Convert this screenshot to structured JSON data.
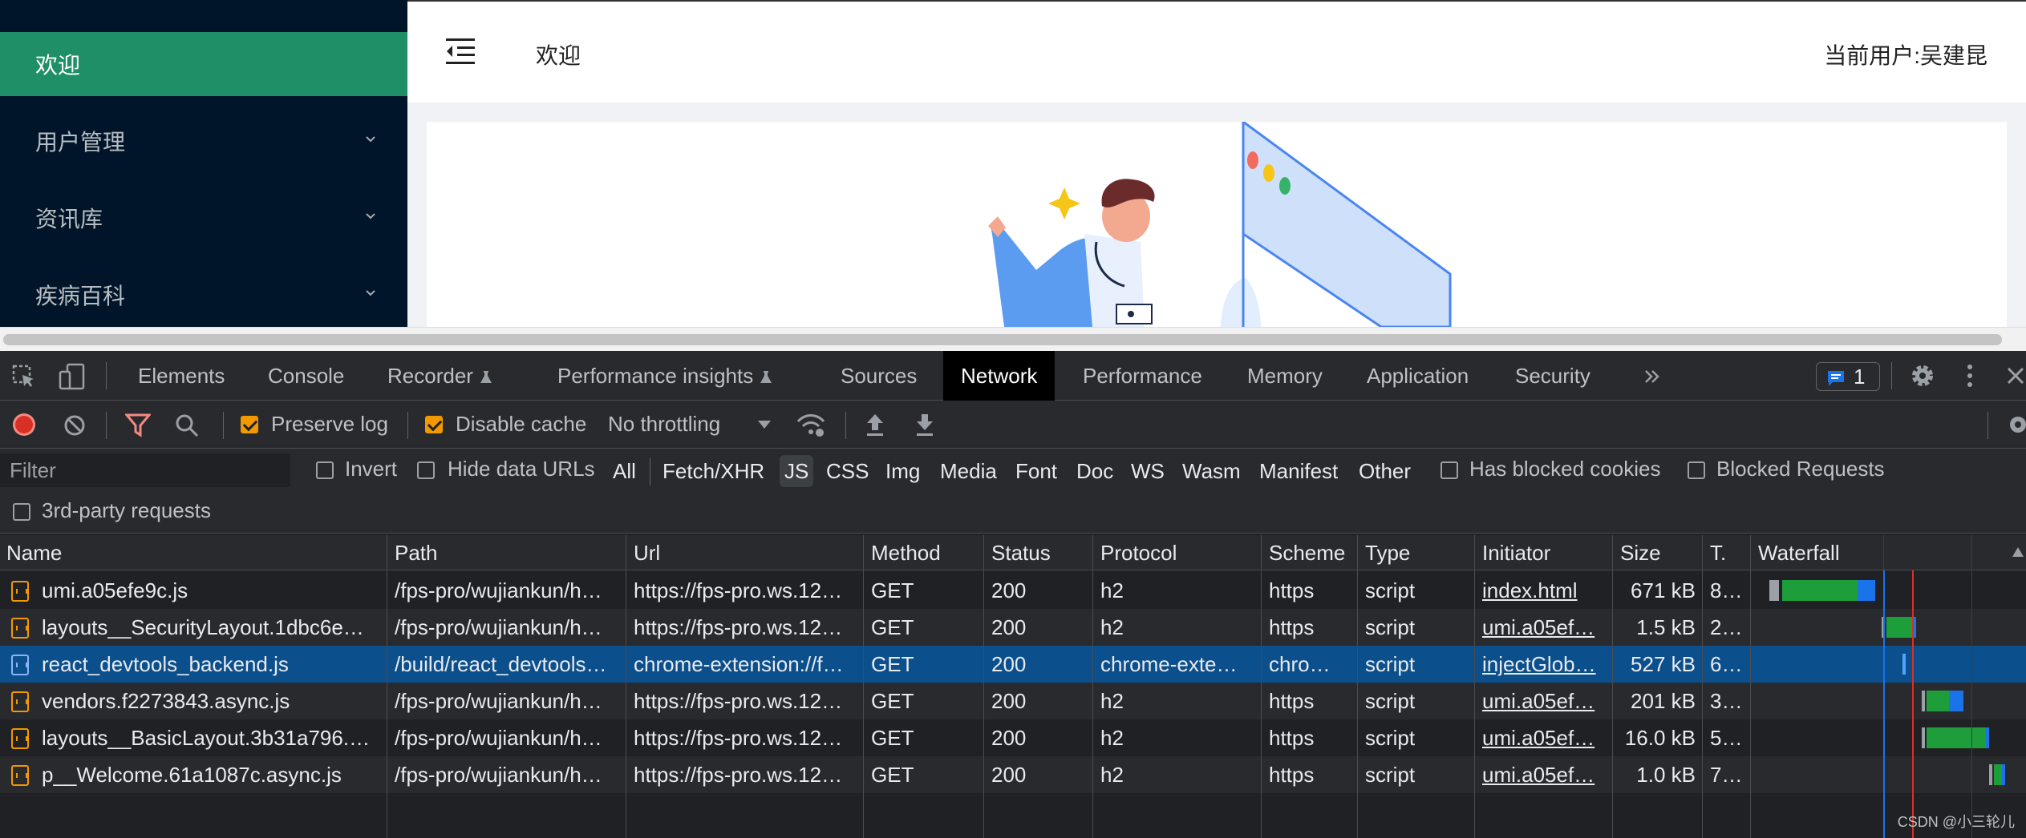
{
  "sidebar": {
    "items": [
      {
        "label": "欢迎",
        "active": true
      },
      {
        "label": "用户管理"
      },
      {
        "label": "资讯库"
      },
      {
        "label": "疾病百科"
      }
    ]
  },
  "header": {
    "title": "欢迎",
    "user": "当前用户:吴建昆"
  },
  "devtools": {
    "tabs": [
      "Elements",
      "Console",
      "Recorder",
      "Performance insights",
      "Sources",
      "Network",
      "Performance",
      "Memory",
      "Application",
      "Security"
    ],
    "active_tab": "Network",
    "issues_count": "1",
    "toolbar": {
      "preserve_log": "Preserve log",
      "disable_cache": "Disable cache",
      "throttling": "No throttling"
    },
    "filter": {
      "placeholder": "Filter",
      "invert": "Invert",
      "hide_data_urls": "Hide data URLs",
      "types": [
        "All",
        "Fetch/XHR",
        "JS",
        "CSS",
        "Img",
        "Media",
        "Font",
        "Doc",
        "WS",
        "Wasm",
        "Manifest",
        "Other"
      ],
      "active_type": "JS",
      "has_blocked_cookies": "Has blocked cookies",
      "blocked_requests": "Blocked Requests",
      "third_party": "3rd-party requests"
    },
    "table": {
      "columns": [
        "Name",
        "Path",
        "Url",
        "Method",
        "Status",
        "Protocol",
        "Scheme",
        "Type",
        "Initiator",
        "Size",
        "T.",
        "Waterfall"
      ],
      "rows": [
        {
          "name": "umi.a05efe9c.js",
          "path": "/fps-pro/wujiankun/h…",
          "url": "https://fps-pro.ws.12…",
          "method": "GET",
          "status": "200",
          "protocol": "h2",
          "scheme": "https",
          "type": "script",
          "initiator": "index.html",
          "size": "671 kB",
          "time": "8…"
        },
        {
          "name": "layouts__SecurityLayout.1dbc6e…",
          "path": "/fps-pro/wujiankun/h…",
          "url": "https://fps-pro.ws.12…",
          "method": "GET",
          "status": "200",
          "protocol": "h2",
          "scheme": "https",
          "type": "script",
          "initiator": "umi.a05ef…",
          "size": "1.5 kB",
          "time": "2…"
        },
        {
          "name": "react_devtools_backend.js",
          "path": "/build/react_devtools…",
          "url": "chrome-extension://f…",
          "method": "GET",
          "status": "200",
          "protocol": "chrome-exte…",
          "scheme": "chro…",
          "type": "script",
          "initiator": "injectGlob…",
          "size": "527 kB",
          "time": "6…"
        },
        {
          "name": "vendors.f2273843.async.js",
          "path": "/fps-pro/wujiankun/h…",
          "url": "https://fps-pro.ws.12…",
          "method": "GET",
          "status": "200",
          "protocol": "h2",
          "scheme": "https",
          "type": "script",
          "initiator": "umi.a05ef…",
          "size": "201 kB",
          "time": "3…"
        },
        {
          "name": "layouts__BasicLayout.3b31a796.…",
          "path": "/fps-pro/wujiankun/h…",
          "url": "https://fps-pro.ws.12…",
          "method": "GET",
          "status": "200",
          "protocol": "h2",
          "scheme": "https",
          "type": "script",
          "initiator": "umi.a05ef…",
          "size": "16.0 kB",
          "time": "5…"
        },
        {
          "name": "p__Welcome.61a1087c.async.js",
          "path": "/fps-pro/wujiankun/h…",
          "url": "https://fps-pro.ws.12…",
          "method": "GET",
          "status": "200",
          "protocol": "h2",
          "scheme": "https",
          "type": "script",
          "initiator": "umi.a05ef…",
          "size": "1.0 kB",
          "time": "7…"
        }
      ],
      "selected_row": 2
    }
  },
  "watermark": "CSDN @小三轮儿",
  "colors": {
    "sider_bg": "#001529",
    "sider_active": "#1f8f68",
    "record": "#f28b82",
    "checkbox": "#f29900",
    "selected_row": "#0b4f8c",
    "waterfall_green": "#1e9e3a",
    "waterfall_blue": "#1a73e8"
  }
}
